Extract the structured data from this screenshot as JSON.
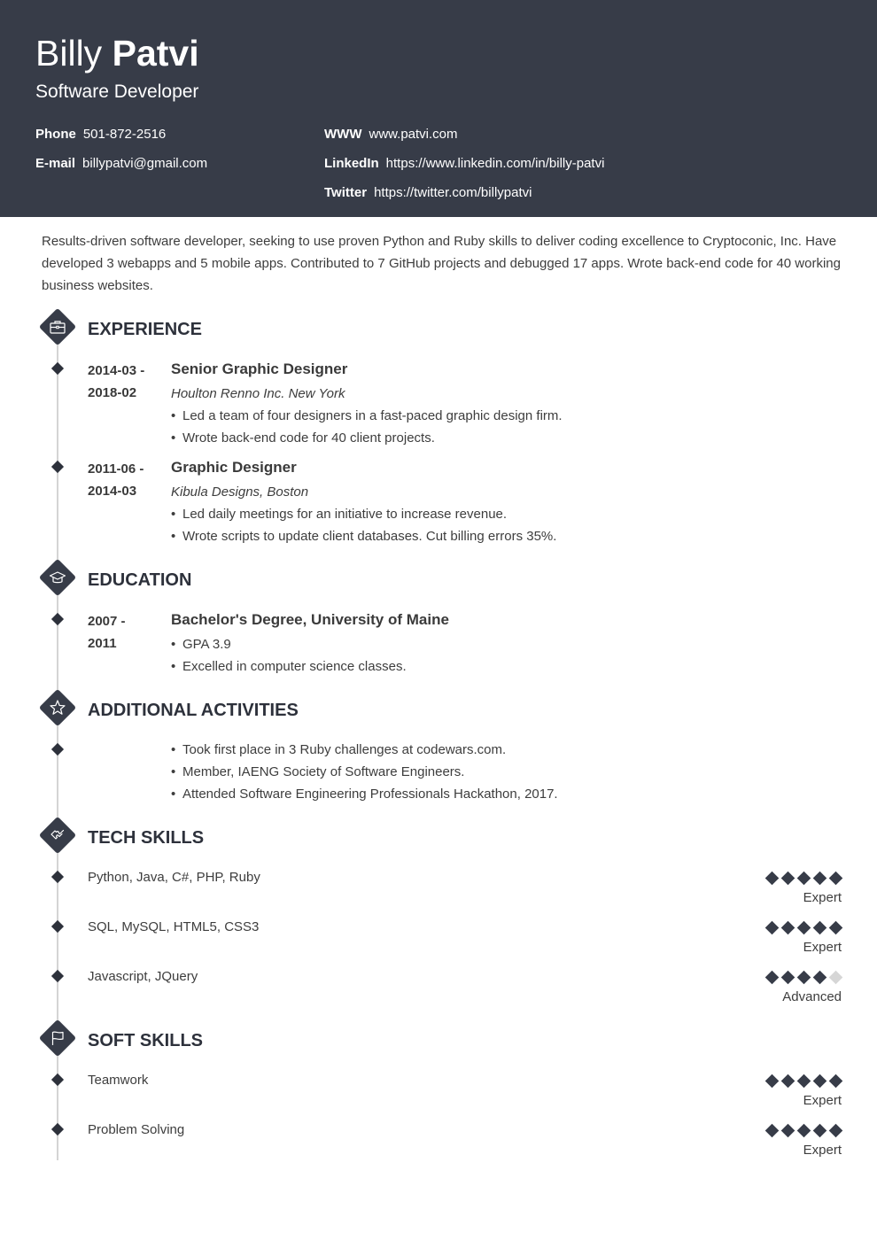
{
  "header": {
    "first_name": "Billy",
    "last_name": "Patvi",
    "job_title": "Software Developer",
    "contacts": [
      {
        "label": "Phone",
        "value": "501-872-2516"
      },
      {
        "label": "E-mail",
        "value": "billypatvi@gmail.com"
      },
      {
        "label": "WWW",
        "value": "www.patvi.com"
      },
      {
        "label": "LinkedIn",
        "value": "https://www.linkedin.com/in/billy-patvi"
      },
      {
        "label": "Twitter",
        "value": "https://twitter.com/billypatvi"
      }
    ]
  },
  "summary": "Results-driven software developer, seeking to use proven Python and Ruby skills to deliver coding excellence to Cryptoconic, Inc. Have developed 3 webapps and 5 mobile apps. Contributed to 7 GitHub projects and debugged 17 apps. Wrote back-end code for 40 working business websites.",
  "sections": {
    "experience": {
      "title": "EXPERIENCE",
      "icon": "briefcase-icon",
      "items": [
        {
          "date_start": "2014-03 -",
          "date_end": "2018-02",
          "role": "Senior Graphic Designer",
          "org": "Houlton Renno Inc. New York",
          "bullets": [
            "Led a team of four designers in a fast-paced graphic design firm.",
            "Wrote back-end code for 40 client projects."
          ]
        },
        {
          "date_start": "2011-06 -",
          "date_end": "2014-03",
          "role": "Graphic Designer",
          "org": "Kibula Designs, Boston",
          "bullets": [
            "Led daily meetings for an initiative to increase revenue.",
            "Wrote scripts to update client databases. Cut billing errors 35%."
          ]
        }
      ]
    },
    "education": {
      "title": "EDUCATION",
      "icon": "graduation-cap-icon",
      "items": [
        {
          "date_start": "2007 -",
          "date_end": "2011",
          "degree": "Bachelor's Degree, University of Maine",
          "bullets": [
            "GPA 3.9",
            "Excelled in computer science classes."
          ]
        }
      ]
    },
    "activities": {
      "title": "ADDITIONAL ACTIVITIES",
      "icon": "star-icon",
      "bullets": [
        "Took first place in 3 Ruby challenges at codewars.com.",
        "Member, IAENG Society of Software Engineers.",
        "Attended Software Engineering Professionals Hackathon, 2017."
      ]
    },
    "tech_skills": {
      "title": "TECH SKILLS",
      "icon": "puzzle-icon",
      "items": [
        {
          "name": "Python, Java, C#, PHP, Ruby",
          "rating": 5,
          "max": 5,
          "level": "Expert"
        },
        {
          "name": "SQL, MySQL, HTML5, CSS3",
          "rating": 5,
          "max": 5,
          "level": "Expert"
        },
        {
          "name": "Javascript, JQuery",
          "rating": 4,
          "max": 5,
          "level": "Advanced"
        }
      ]
    },
    "soft_skills": {
      "title": "SOFT SKILLS",
      "icon": "flag-icon",
      "items": [
        {
          "name": "Teamwork",
          "rating": 5,
          "max": 5,
          "level": "Expert"
        },
        {
          "name": "Problem Solving",
          "rating": 5,
          "max": 5,
          "level": "Expert"
        }
      ]
    }
  },
  "colors": {
    "header_bg": "#373c48",
    "accent": "#373c48",
    "rating_off": "#d6d6d6",
    "timeline": "#d4d4d4"
  }
}
